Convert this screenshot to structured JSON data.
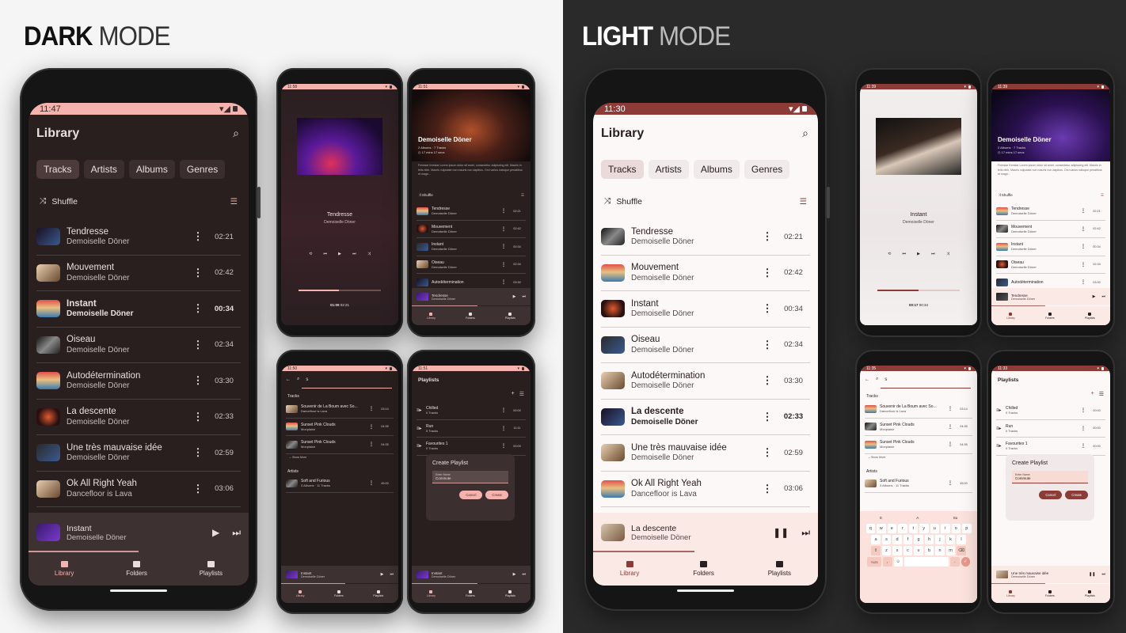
{
  "headings": {
    "dark_bold": "DARK",
    "dark_rest": "MODE",
    "light_bold": "LIGHT",
    "light_rest": "MODE"
  },
  "colors": {
    "dark_bg": "#2a1f1f",
    "dark_accent": "#f4b3ad",
    "light_bg": "#fdf8f8",
    "light_accent": "#8c3b36"
  },
  "library_dark": {
    "status_time": "11:47",
    "title": "Library",
    "tabs": [
      "Tracks",
      "Artists",
      "Albums",
      "Genres"
    ],
    "shuffle": "Shuffle",
    "tracks": [
      {
        "title": "Tendresse",
        "artist": "Demoiselle Döner",
        "duration": "02:21"
      },
      {
        "title": "Mouvement",
        "artist": "Demoiselle Döner",
        "duration": "02:42"
      },
      {
        "title": "Instant",
        "artist": "Demoiselle Döner",
        "duration": "00:34"
      },
      {
        "title": "Oiseau",
        "artist": "Demoiselle Döner",
        "duration": "02:34"
      },
      {
        "title": "Autodétermination",
        "artist": "Demoiselle Döner",
        "duration": "03:30"
      },
      {
        "title": "La descente",
        "artist": "Demoiselle Döner",
        "duration": "02:33"
      },
      {
        "title": "Une très mauvaise idée",
        "artist": "Demoiselle Döner",
        "duration": "02:59"
      },
      {
        "title": "Ok All Right Yeah",
        "artist": "Dancefloor is Lava",
        "duration": "03:06"
      }
    ],
    "now_playing_index": 2,
    "mini_player": {
      "title": "Instant",
      "artist": "Demoiselle Döner",
      "progress": 0.5
    },
    "nav": [
      "Library",
      "Folders",
      "Playlists"
    ]
  },
  "library_light": {
    "status_time": "11:30",
    "title": "Library",
    "tabs": [
      "Tracks",
      "Artists",
      "Albums",
      "Genres"
    ],
    "shuffle": "Shuffle",
    "tracks": [
      {
        "title": "Tendresse",
        "artist": "Demoiselle Döner",
        "duration": "02:21"
      },
      {
        "title": "Mouvement",
        "artist": "Demoiselle Döner",
        "duration": "02:42"
      },
      {
        "title": "Instant",
        "artist": "Demoiselle Döner",
        "duration": "00:34"
      },
      {
        "title": "Oiseau",
        "artist": "Demoiselle Döner",
        "duration": "02:34"
      },
      {
        "title": "Autodétermination",
        "artist": "Demoiselle Döner",
        "duration": "03:30"
      },
      {
        "title": "La descente",
        "artist": "Demoiselle Döner",
        "duration": "02:33"
      },
      {
        "title": "Une très mauvaise idée",
        "artist": "Demoiselle Döner",
        "duration": "02:59"
      },
      {
        "title": "Ok All Right Yeah",
        "artist": "Dancefloor is Lava",
        "duration": "03:06"
      }
    ],
    "now_playing_index": 5,
    "mini_player": {
      "title": "La descente",
      "artist": "Demoiselle Döner",
      "progress": 0.45
    },
    "nav": [
      "Library",
      "Folders",
      "Playlists"
    ]
  },
  "nowplaying_dark": {
    "status_time": "11:58",
    "title": "Tendresse",
    "artist": "Demoiselle Döner",
    "elapsed": "01:09",
    "total": "02:21",
    "progress": 0.49
  },
  "nowplaying_light": {
    "status_time": "11:39",
    "title": "Instant",
    "artist": "Demoiselle Döner",
    "elapsed": "00:17",
    "total": "00:34",
    "progress": 0.5
  },
  "artist_dark": {
    "status_time": "11:51",
    "name": "Demoiselle Döner",
    "stats": "2 Albums · 7 Tracks",
    "duration": "17 mins 17 secs",
    "bio": "Freestar freestar Lorem ipsum dolor sit amet, consectetur adipiscing elit. Mauris in felis nibh. Mauris vulputate non mauris non dapibus. Orci varius natoque penatibus et magn...",
    "shuffle": "Shuffle",
    "tracks": [
      {
        "title": "Tendresse",
        "artist": "Demoiselle Döner",
        "duration": "02:21"
      },
      {
        "title": "Mouvement",
        "artist": "Demoiselle Döner",
        "duration": "02:42"
      },
      {
        "title": "Instant",
        "artist": "Demoiselle Döner",
        "duration": "00:34"
      },
      {
        "title": "Oiseau",
        "artist": "Demoiselle Döner",
        "duration": "02:34"
      },
      {
        "title": "Autodétermination",
        "artist": "",
        "duration": "03:30"
      }
    ],
    "mini_player": {
      "title": "Tendresse",
      "artist": "Demoiselle Döner"
    },
    "nav": [
      "Library",
      "Folders",
      "Playlists"
    ]
  },
  "artist_light": {
    "status_time": "11:39",
    "name": "Demoiselle Döner",
    "stats": "2 Albums · 7 Tracks",
    "duration": "17 mins 17 secs",
    "bio": "Freestar freestar Lorem ipsum dolor sit amet, consectetur adipiscing elit. Mauris in felis nibh. Mauris vulputate non mauris non dapibus. Orci varius natoque penatibus et magn...",
    "shuffle": "Shuffle",
    "tracks": [
      {
        "title": "Tendresse",
        "artist": "Demoiselle Döner",
        "duration": "02:21"
      },
      {
        "title": "Mouvement",
        "artist": "Demoiselle Döner",
        "duration": "02:42"
      },
      {
        "title": "Instant",
        "artist": "Demoiselle Döner",
        "duration": "00:34"
      },
      {
        "title": "Oiseau",
        "artist": "Demoiselle Döner",
        "duration": "02:34"
      },
      {
        "title": "Autodétermination",
        "artist": "",
        "duration": "03:30"
      }
    ],
    "mini_player": {
      "title": "Tendresse",
      "artist": "Demoiselle Döner"
    },
    "nav": [
      "Library",
      "Folders",
      "Playlists"
    ]
  },
  "search_dark": {
    "status_time": "11:50",
    "query": "s",
    "tracks_label": "Tracks",
    "tracks": [
      {
        "title": "Souvenir de La Boum avec So...",
        "artist": "Dancefloor is Lava",
        "duration": "03:14"
      },
      {
        "title": "Sunset Pink Clouds",
        "artist": "Monplaisir",
        "duration": "04:35"
      },
      {
        "title": "Sunset Pink Clouds",
        "artist": "Monplaisir",
        "duration": "04:35"
      }
    ],
    "show_more": "Show More",
    "artists_label": "Artists",
    "artists": [
      {
        "title": "Soft and Furious",
        "artist": "3 Albums · 11 Tracks",
        "duration": "45:00"
      }
    ],
    "mini_player": {
      "title": "Instant",
      "artist": "Demoiselle Döner"
    },
    "nav": [
      "Library",
      "Folders",
      "Playlists"
    ]
  },
  "search_light": {
    "status_time": "11:35",
    "query": "s",
    "tracks_label": "Tracks",
    "tracks": [
      {
        "title": "Souvenir de La Boum avec So...",
        "artist": "Dancefloor is Lava",
        "duration": "03:14"
      },
      {
        "title": "Sunset Pink Clouds",
        "artist": "Monplaisir",
        "duration": "04:35"
      },
      {
        "title": "Sunset Pink Clouds",
        "artist": "Monplaisir",
        "duration": "04:35"
      }
    ],
    "show_more": "Show More",
    "artists_label": "Artists",
    "artists": [
      {
        "title": "Soft and Furious",
        "artist": "3 Albums · 11 Tracks",
        "duration": "45:00"
      }
    ],
    "keyboard": {
      "suggestions": [
        "S",
        "A",
        "So"
      ],
      "row1": [
        "q",
        "w",
        "e",
        "r",
        "t",
        "y",
        "u",
        "i",
        "o",
        "p"
      ],
      "row2": [
        "a",
        "s",
        "d",
        "f",
        "g",
        "h",
        "j",
        "k",
        "l"
      ],
      "row3": [
        "z",
        "x",
        "c",
        "v",
        "b",
        "n",
        "m"
      ],
      "mode_key": "?123"
    }
  },
  "playlists_dark": {
    "status_time": "11:51",
    "title": "Playlists",
    "playlists": [
      {
        "title": "Chilled",
        "artist": "0 Tracks",
        "duration": "00:00"
      },
      {
        "title": "Run",
        "artist": "5 Tracks",
        "duration": "11:11"
      },
      {
        "title": "Favourites 1",
        "artist": "0 Tracks",
        "duration": "00:00"
      }
    ],
    "dialog": {
      "title": "Create Playlist",
      "label": "Enter Name",
      "value": "Commute",
      "cancel": "Cancel",
      "create": "Create"
    },
    "mini_player": {
      "title": "Instant",
      "artist": "Demoiselle Döner"
    },
    "nav": [
      "Library",
      "Folders",
      "Playlists"
    ]
  },
  "playlists_light": {
    "status_time": "11:33",
    "title": "Playlists",
    "playlists": [
      {
        "title": "Chilled",
        "artist": "0 Tracks",
        "duration": "00:00"
      },
      {
        "title": "Run",
        "artist": "0 Tracks",
        "duration": "00:00"
      },
      {
        "title": "Favourites 1",
        "artist": "0 Tracks",
        "duration": "00:00"
      }
    ],
    "dialog": {
      "title": "Create Playlist",
      "label": "Enter Name",
      "value": "Commute",
      "cancel": "Cancel",
      "create": "Create"
    },
    "mini_player": {
      "title": "Une très mauvaise idée",
      "artist": "Demoiselle Döner"
    },
    "nav": [
      "Library",
      "Folders",
      "Playlists"
    ]
  }
}
